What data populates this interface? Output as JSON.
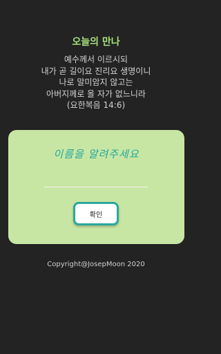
{
  "header": {
    "title": "오늘의 만나"
  },
  "verse": {
    "lines": [
      "예수께서 이르시되",
      "내가 곧 길이요 진리요 생명이니",
      "나로 말미암지 않고는",
      "아버지께로 올 자가 없느니라",
      "(요한복음 14:6)"
    ]
  },
  "card": {
    "prompt": "이름을 알려주세요",
    "name_input": {
      "value": "",
      "placeholder": ""
    },
    "confirm_label": "확인"
  },
  "footer": {
    "copyright": "Copyright@JosepMoon 2020"
  },
  "colors": {
    "background": "#232323",
    "title": "#a6e07a",
    "card": "#c8e6a3",
    "accent": "#2ba79d"
  }
}
